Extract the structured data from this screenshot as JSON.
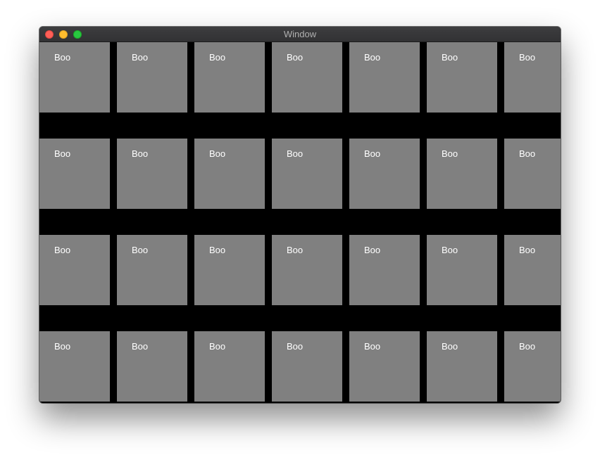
{
  "window": {
    "title": "Window"
  },
  "grid": {
    "rows": [
      {
        "tiles": [
          {
            "label": "Boo"
          },
          {
            "label": "Boo"
          },
          {
            "label": "Boo"
          },
          {
            "label": "Boo"
          },
          {
            "label": "Boo"
          },
          {
            "label": "Boo"
          },
          {
            "label": "Boo"
          }
        ]
      },
      {
        "tiles": [
          {
            "label": "Boo"
          },
          {
            "label": "Boo"
          },
          {
            "label": "Boo"
          },
          {
            "label": "Boo"
          },
          {
            "label": "Boo"
          },
          {
            "label": "Boo"
          },
          {
            "label": "Boo"
          }
        ]
      },
      {
        "tiles": [
          {
            "label": "Boo"
          },
          {
            "label": "Boo"
          },
          {
            "label": "Boo"
          },
          {
            "label": "Boo"
          },
          {
            "label": "Boo"
          },
          {
            "label": "Boo"
          },
          {
            "label": "Boo"
          }
        ]
      },
      {
        "tiles": [
          {
            "label": "Boo"
          },
          {
            "label": "Boo"
          },
          {
            "label": "Boo"
          },
          {
            "label": "Boo"
          },
          {
            "label": "Boo"
          },
          {
            "label": "Boo"
          },
          {
            "label": "Boo"
          }
        ]
      }
    ]
  },
  "colors": {
    "tile": "#808080",
    "background": "#000000",
    "label": "#ffffff"
  }
}
